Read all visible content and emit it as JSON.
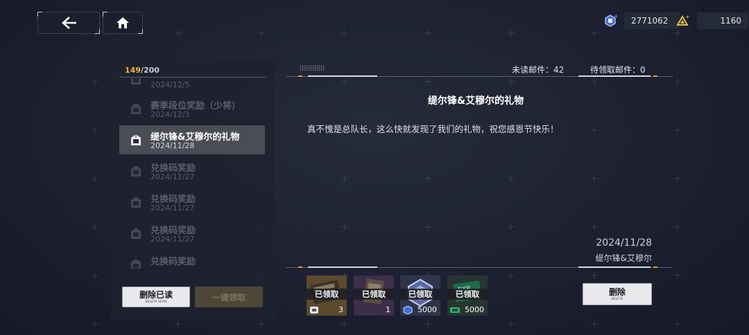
{
  "topbar": {
    "back_icon": "back-arrow-icon",
    "home_icon": "home-icon",
    "currency1": {
      "icon": "blue-gem-icon",
      "value": "2771062"
    },
    "currency2": {
      "icon": "gold-triangle-icon",
      "value": "1160"
    }
  },
  "mailbox": {
    "count_current": "149",
    "count_max": "/200",
    "items": [
      {
        "title": "",
        "date": "2024/12/5"
      },
      {
        "title": "赛季段位奖励（少将）",
        "date": "2024/12/3"
      },
      {
        "title": "缇尔锋&艾穆尔的礼物",
        "date": "2024/11/28"
      },
      {
        "title": "兑换码奖励",
        "date": "2024/11/27"
      },
      {
        "title": "兑换码奖励",
        "date": "2024/11/27"
      },
      {
        "title": "兑换码奖励",
        "date": "2024/11/27"
      },
      {
        "title": "兑换码奖励",
        "date": ""
      }
    ],
    "delete_read": {
      "label": "删除已读",
      "sub": "DELETE READ"
    },
    "claim_all": {
      "label": "一键领取"
    }
  },
  "stats": {
    "unread": "未读邮件：42",
    "pending": "待领取邮件：0"
  },
  "mail": {
    "title": "缇尔锋&艾穆尔的礼物",
    "body": "真不愧是总队长，这么快就发现了我们的礼物，祝您感恩节快乐！",
    "date": "2024/11/28",
    "sender": "缇尔锋&艾穆尔"
  },
  "rewards": [
    {
      "claimed": "已领取",
      "qty": "3"
    },
    {
      "claimed": "已领取",
      "qty": "1"
    },
    {
      "claimed": "已领取",
      "qty": "5000"
    },
    {
      "claimed": "已领取",
      "qty": "5000"
    }
  ],
  "delete_button": {
    "label": "删除",
    "sub": "DELETE"
  },
  "colors": {
    "accent_gold": "#f1b23c",
    "marker_orange": "#e0a13a"
  }
}
